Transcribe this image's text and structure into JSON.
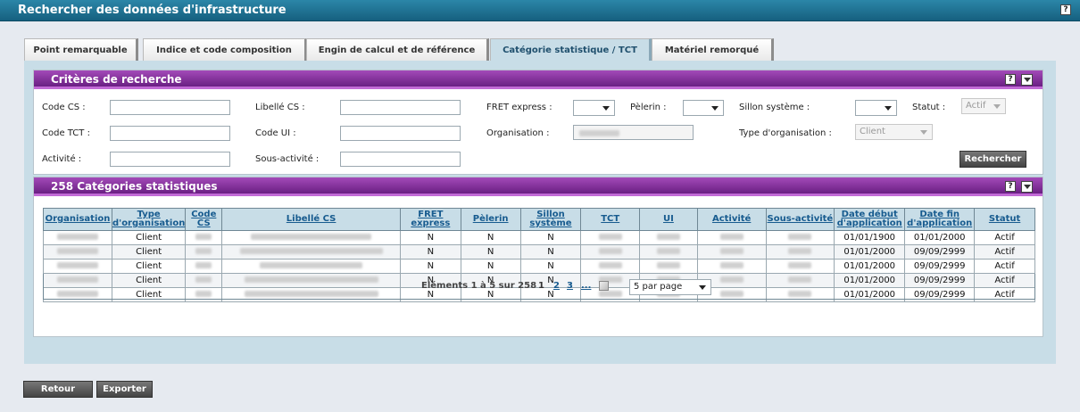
{
  "window": {
    "title": "Rechercher des données d'infrastructure",
    "help": "?"
  },
  "tabs": [
    {
      "label": "Point remarquable"
    },
    {
      "label": "Indice et code composition"
    },
    {
      "label": "Engin de calcul et de référence"
    },
    {
      "label": "Catégorie statistique / TCT"
    },
    {
      "label": "Matériel remorqué"
    }
  ],
  "criteria": {
    "title": "Critères de recherche",
    "help": "?",
    "code_cs": "Code CS :",
    "libelle_cs": "Libellé CS :",
    "fret_express": "FRET express :",
    "pelerin": "Pèlerin :",
    "sillon_systeme": "Sillon système :",
    "statut": "Statut :",
    "statut_value": "Actif",
    "code_tct": "Code TCT :",
    "code_ui": "Code UI :",
    "organisation": "Organisation :",
    "type_organisation": "Type d'organisation :",
    "type_organisation_value": "Client",
    "activite": "Activité :",
    "sous_activite": "Sous-activité :",
    "search_button": "Rechercher"
  },
  "results": {
    "title": "258 Catégories statistiques",
    "help": "?",
    "columns": [
      "Organisation",
      "Type d'organisation",
      "Code CS",
      "Libellé CS",
      "FRET express",
      "Pèlerin",
      "Sillon système",
      "TCT",
      "UI",
      "Activité",
      "Sous-activité",
      "Date début d'application",
      "Date fin d'application",
      "Statut"
    ],
    "rows": [
      {
        "type": "Client",
        "fret": "N",
        "pelerin": "N",
        "sillon": "N",
        "debut": "01/01/1900",
        "fin": "01/01/2000",
        "statut": "Actif"
      },
      {
        "type": "Client",
        "fret": "N",
        "pelerin": "N",
        "sillon": "N",
        "debut": "01/01/2000",
        "fin": "09/09/2999",
        "statut": "Actif"
      },
      {
        "type": "Client",
        "fret": "N",
        "pelerin": "N",
        "sillon": "N",
        "debut": "01/01/2000",
        "fin": "09/09/2999",
        "statut": "Actif"
      },
      {
        "type": "Client",
        "fret": "N",
        "pelerin": "N",
        "sillon": "N",
        "debut": "01/01/2000",
        "fin": "09/09/2999",
        "statut": "Actif"
      },
      {
        "type": "Client",
        "fret": "N",
        "pelerin": "N",
        "sillon": "N",
        "debut": "01/01/2000",
        "fin": "09/09/2999",
        "statut": "Actif"
      }
    ],
    "pager": {
      "summary": "Eléments 1 à 5 sur 258",
      "current_page": "1",
      "pages": [
        "2",
        "3"
      ],
      "more": "...",
      "page_size": "5 par page"
    }
  },
  "footer": {
    "back_button": "Retour",
    "export_button": "Exporter"
  }
}
